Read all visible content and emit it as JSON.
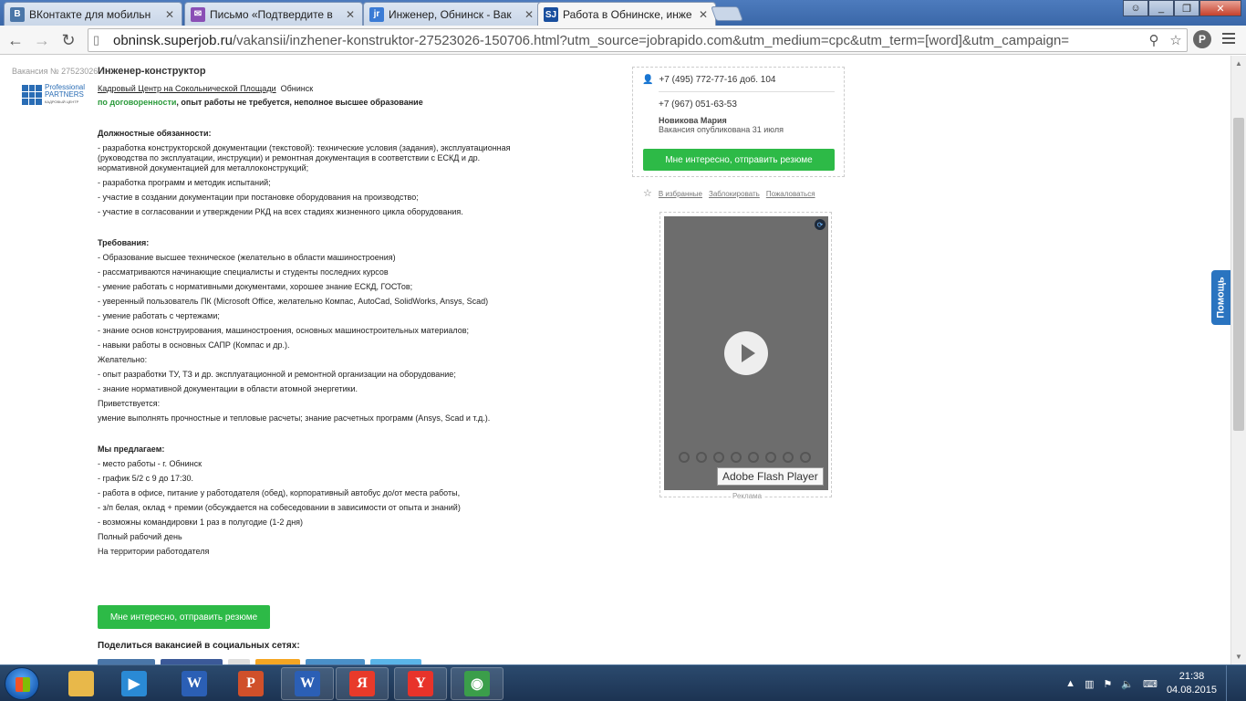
{
  "browser": {
    "tabs": [
      {
        "title": "ВКонтакте для мобильн",
        "favicon": "vk-icon",
        "color": "#4a76a8",
        "glyph": "В"
      },
      {
        "title": "Письмо «Подтвердите в",
        "favicon": "mail-icon",
        "color": "#8a4fb5",
        "glyph": "✉"
      },
      {
        "title": "Инженер, Обнинск - Вак",
        "favicon": "jobrapido-icon",
        "color": "#3a7bd5",
        "glyph": "jr"
      },
      {
        "title": "Работа в Обнинске, инже",
        "favicon": "superjob-icon",
        "color": "#1a4f9e",
        "glyph": "SJ"
      }
    ],
    "url_host": "obninsk.superjob.ru",
    "url_rest": "/vakansii/inzhener-konstruktor-27523026-150706.html?utm_source=jobrapido.com&utm_medium=cpc&utm_term=[word]&utm_campaign="
  },
  "vacancy": {
    "number_label": "Вакансия № 27523026",
    "logo_text_1": "Professional",
    "logo_text_2": "PARTNERS",
    "logo_text_3": "КАДРОВЫЙ ЦЕНТР",
    "title": "Инженер-конструктор",
    "company": "Кадровый Центр на Сокольнической Площади",
    "city": "Обнинск",
    "salary": "по договоренности",
    "conditions": ", опыт работы не требуется, неполное высшее образование",
    "duties_title": "Должностные обязанности:",
    "duties": [
      "- разработка конструкторской документации (текстовой): технические условия (задания), эксплуатационная (руководства по эксплуатации, инструкции) и ремонтная документация в соответствии с ЕСКД и др. нормативной документацией для металлоконструкций;",
      "- разработка программ и методик испытаний;",
      "- участие в создании документации при постановке оборудования на производство;",
      "- участие в согласовании и утверждении РКД на всех стадиях жизненного цикла оборудования."
    ],
    "requirements_title": "Требования:",
    "requirements": [
      "- Образование высшее техническое (желательно в области машиностроения)",
      "- рассматриваются начинающие специалисты и студенты последних курсов",
      "- умение работать с нормативными документами, хорошее знание ЕСКД, ГОСТов;",
      "- уверенный пользователь ПК (Microsoft Office, желательно Компас, AutoCad, SolidWorks, Ansys, Scad)",
      "- умение работать с чертежами;",
      "- знание основ конструирования, машиностроения, основных машиностроительных материалов;",
      "- навыки работы в основных САПР (Компас и др.).",
      "Желательно:",
      "- опыт разработки ТУ, ТЗ и др. эксплуатационной и ремонтной организации на оборудование;",
      "- знание нормативной документации в области атомной энергетики.",
      "Приветствуется:",
      "умение выполнять прочностные и тепловые расчеты; знание расчетных программ (Ansys, Scad и т.д.)."
    ],
    "offer_title": "Мы предлагаем:",
    "offer": [
      "- место работы - г. Обнинск",
      "- график 5/2 с 9 до 17:30.",
      "- работа в офисе, питание у работодателя (обед), корпоративный автобус до/от места работы,",
      "- з/п белая, оклад + премии (обсуждается на собеседовании в зависимости от опыта и знаний)",
      "- возможны командировки 1 раз в полугодие (1-2 дня)",
      "Полный рабочий день",
      "На территории работодателя"
    ],
    "apply_button": "Мне интересно, отправить резюме",
    "share_title": "Поделиться вакансией в социальных сетях:"
  },
  "contact": {
    "phone1": "+7 (495) 772-77-16 доб. 104",
    "phone2": "+7 (967) 051-63-53",
    "person": "Новикова Мария",
    "published": "Вакансия опубликована 31 июля",
    "apply_button": "Мне интересно, отправить резюме"
  },
  "actions": {
    "favorite": "В избранные",
    "block": "Заблокировать",
    "complain": "Пожаловаться"
  },
  "ad": {
    "tooltip": "Adobe Flash Player",
    "label": "Реклама"
  },
  "help_tab": "Помощь",
  "taskbar": {
    "apps": [
      {
        "name": "explorer-icon",
        "color": "#e8b84a",
        "glyph": ""
      },
      {
        "name": "media-player-icon",
        "color": "#2a8ad5",
        "glyph": "▶"
      },
      {
        "name": "word-doc-icon",
        "color": "#2b5fb5",
        "glyph": "W"
      },
      {
        "name": "powerpoint-icon",
        "color": "#d0502a",
        "glyph": "P"
      },
      {
        "name": "word-icon",
        "color": "#2b5fb5",
        "glyph": "W"
      },
      {
        "name": "yandex-icon",
        "color": "#e83a2a",
        "glyph": "Я"
      },
      {
        "name": "yandex-browser-icon",
        "color": "#e8332a",
        "glyph": "Y"
      },
      {
        "name": "chrome-icon",
        "color": "#3b9e4a",
        "glyph": "◉"
      }
    ],
    "time": "21:38",
    "date": "04.08.2015"
  }
}
